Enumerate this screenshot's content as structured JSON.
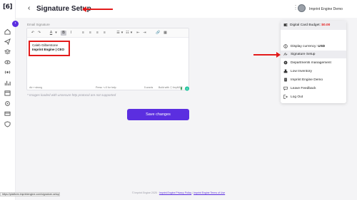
{
  "app": {
    "logo_text": "[6]"
  },
  "header": {
    "back_symbol": "‹",
    "title": "Signature Setup",
    "user_name": "Imprint Engine Demo"
  },
  "editor": {
    "label": "Email Signature",
    "signature_line1": "Caleb Gilberstone",
    "signature_line2": "Imprint Engine | CEO",
    "status_path": "div » strong",
    "status_help": "Press ⌥0 for help",
    "status_words": "5 words",
    "status_built": "Build with ⓣ tinyMCE",
    "toolbar": [
      "↶",
      "↷",
      "A",
      "▾",
      "B",
      "I",
      "≡",
      "≡",
      "≡",
      "≡",
      "☰",
      "▾",
      "☷",
      "▾",
      "⇤",
      "⇥",
      "🔗",
      "▦"
    ]
  },
  "warning": "* Images loaded with unsecure http protocol are not supported",
  "save_button": "Save changes",
  "footer": {
    "copyright": "© Imprint Engine 2025",
    "privacy": "Imprint Engine Privacy Policy",
    "terms": "Imprint Engine Terms of Use"
  },
  "status_url": "https://platform.imprintengine.com/signature-setup",
  "dropdown": {
    "budget_label": "Digital Card Budget:",
    "budget_value": "$0.00",
    "currency_label": "Display currency:",
    "currency_value": "USD",
    "items": [
      {
        "label": "Signature Setup",
        "icon": "signature-icon"
      },
      {
        "label": "Departments management",
        "icon": "dollar-icon"
      },
      {
        "label": "Low Inventory",
        "icon": "boxes-icon"
      },
      {
        "label": "Imprint Engine Demo",
        "icon": "building-icon"
      },
      {
        "label": "Leave Feedback",
        "icon": "feedback-icon"
      },
      {
        "label": "Log Out",
        "icon": "logout-icon"
      }
    ]
  },
  "colors": {
    "accent": "#5b2ee0",
    "annotation": "#e31b1b"
  }
}
